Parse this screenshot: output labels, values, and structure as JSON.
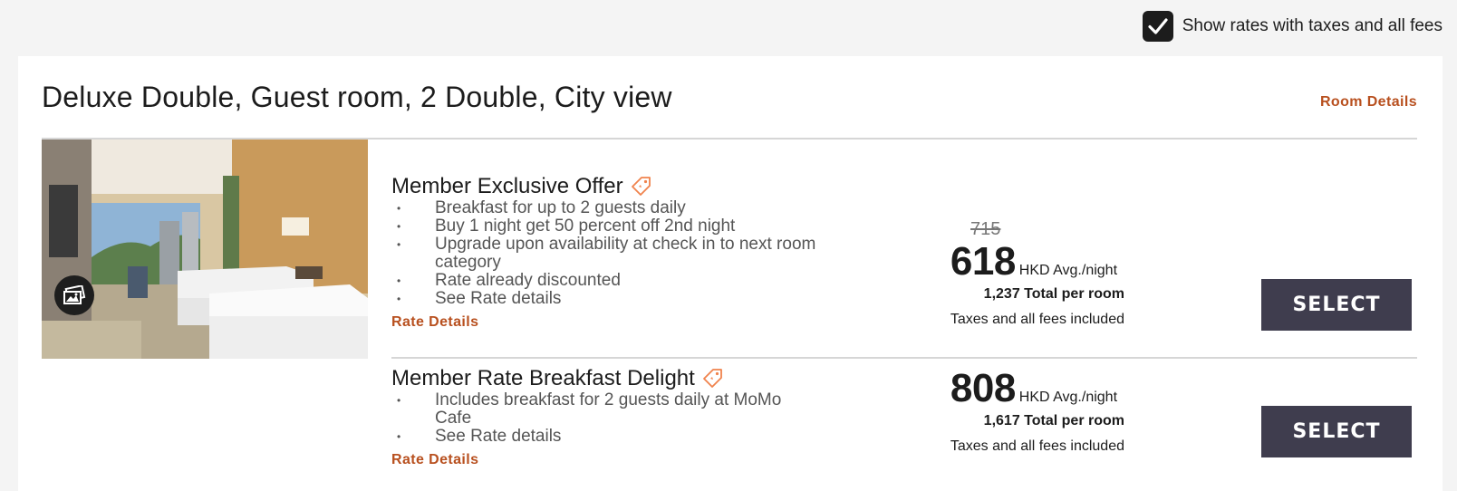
{
  "filter": {
    "label": "Show rates with taxes and all fees",
    "checked": true
  },
  "room": {
    "title": "Deluxe Double, Guest room, 2 Double, City view",
    "details_link": "Room Details"
  },
  "rates": [
    {
      "title": "Member Exclusive Offer",
      "features": [
        "Breakfast for up to 2 guests daily",
        "Buy 1 night get 50 percent off 2nd night",
        "Upgrade upon availability at check in to next room category",
        "Rate already discounted",
        "See Rate details"
      ],
      "details_link": "Rate Details",
      "old_price": "715",
      "price": "618",
      "price_unit": "HKD Avg./night",
      "total_amount": "1,237",
      "total_label": "Total per room",
      "taxes_note": "Taxes and all fees included",
      "select_label": "SELECT"
    },
    {
      "title": "Member Rate Breakfast Delight",
      "features": [
        "Includes breakfast for 2 guests daily at MoMo Cafe",
        "See Rate details"
      ],
      "details_link": "Rate Details",
      "price": "808",
      "price_unit": "HKD Avg./night",
      "total_amount": "1,617",
      "total_label": "Total per room",
      "taxes_note": "Taxes and all fees included",
      "select_label": "SELECT"
    }
  ],
  "colors": {
    "accent_link": "#b8501f",
    "button_bg": "#3f3d4e",
    "tag_icon": "#f0834d"
  },
  "icons": {
    "checkbox": "checkmark-icon",
    "gallery": "photo-gallery-icon",
    "offer_tag": "price-tag-icon"
  }
}
